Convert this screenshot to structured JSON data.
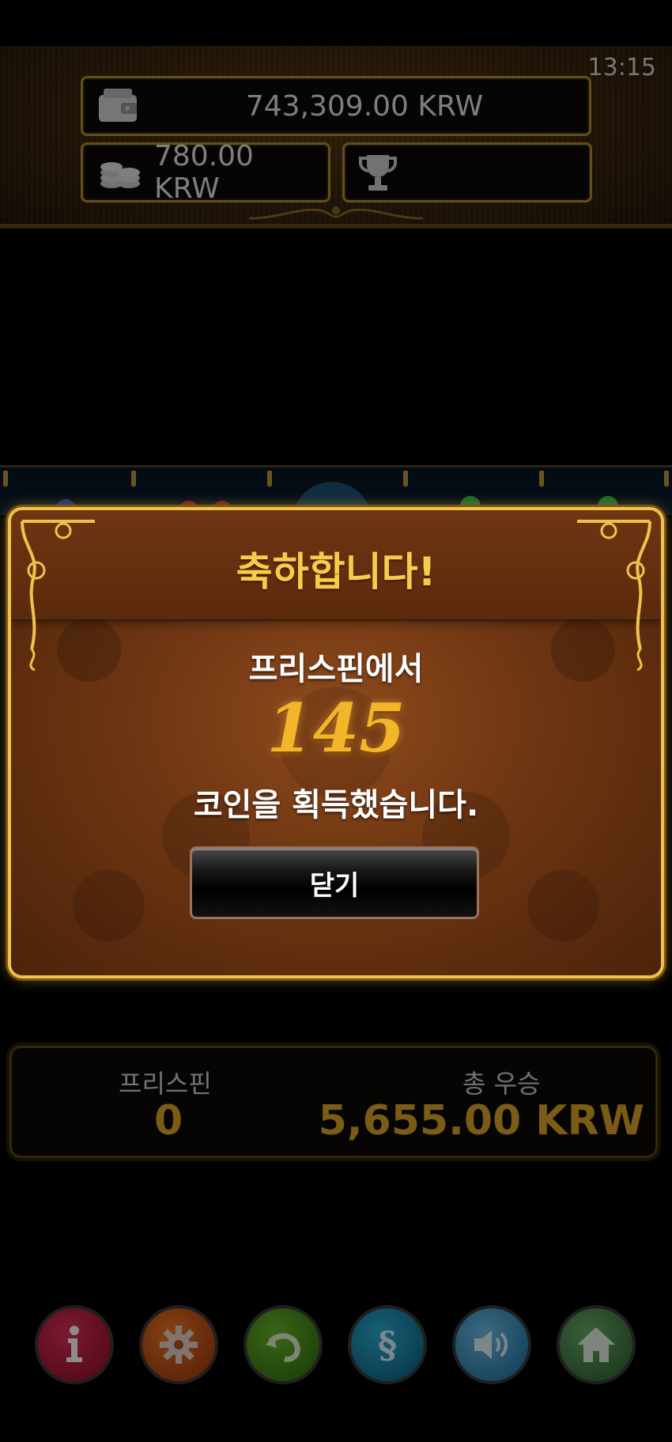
{
  "status_bar": {
    "time": "13:15"
  },
  "header": {
    "balance": "743,309.00 KRW",
    "bet": "780.00 KRW",
    "win": "",
    "icons": [
      "wallet-icon",
      "coins-icon",
      "trophy-icon"
    ]
  },
  "modal": {
    "title": "축하합니다!",
    "line1": "프리스핀에서",
    "amount": "145",
    "line2": "코인을 획득했습니다.",
    "close_label": "닫기"
  },
  "info": {
    "freespins_label": "프리스핀",
    "freespins_value": "0",
    "total_win_label": "총 우승",
    "total_win_value": "5,655.00 KRW"
  },
  "bottom_buttons": [
    {
      "icon": "info-icon",
      "color": "#c2183c"
    },
    {
      "icon": "gear-icon",
      "color": "#d4561a"
    },
    {
      "icon": "back-arrow-icon",
      "color": "#3d8a1e"
    },
    {
      "icon": "paytable-icon",
      "color": "#1a8fb8"
    },
    {
      "icon": "speaker-icon",
      "color": "#4aa0d6"
    },
    {
      "icon": "home-icon",
      "color": "#4a8a4a"
    }
  ],
  "colors": {
    "gold": "#f6cc4c",
    "amount": "#f3b62a",
    "panel_value": "#e1a82a"
  }
}
